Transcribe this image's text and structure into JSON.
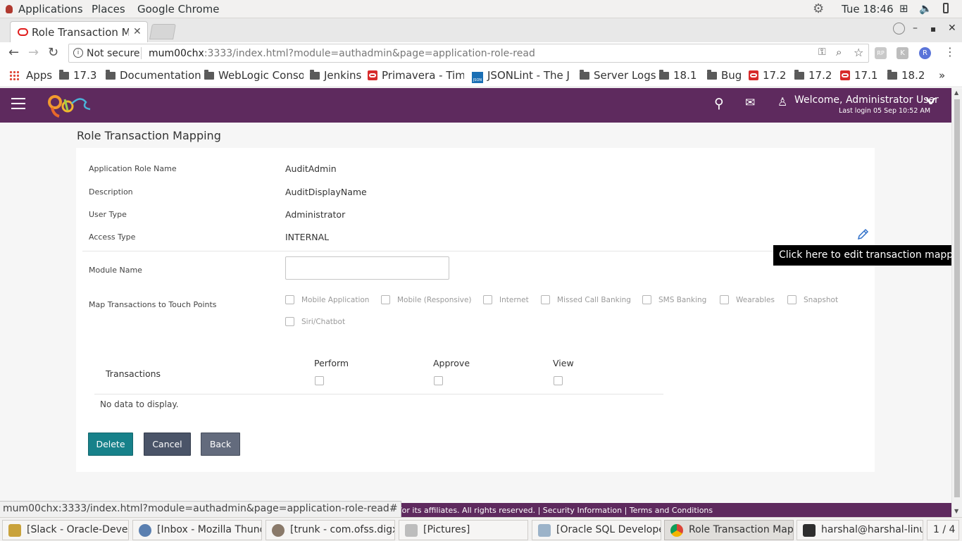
{
  "gnome": {
    "applications": "Applications",
    "places": "Places",
    "app_name": "Google Chrome",
    "clock": "Tue 18:46"
  },
  "browser": {
    "tab_title": "Role Transaction Ma",
    "not_secure": "Not secure",
    "url_host": "mum00chx",
    "url_rest": ":3333/index.html?module=authadmin&page=application-role-read",
    "ext_rp": "RP",
    "ext_k": "K",
    "ext_r": "R",
    "more": "»"
  },
  "bookmarks": {
    "apps": "Apps",
    "items": [
      {
        "label": "17.3",
        "icon": "folder-icon"
      },
      {
        "label": "Documentation",
        "icon": "folder-icon"
      },
      {
        "label": "WebLogic Conso",
        "icon": "folder-icon"
      },
      {
        "label": "Jenkins",
        "icon": "folder-icon"
      },
      {
        "label": "Primavera - Time",
        "icon": "oracle-icon"
      },
      {
        "label": "JSONLint - The J",
        "icon": "json-icon"
      },
      {
        "label": "Server Logs",
        "icon": "folder-icon"
      },
      {
        "label": "18.1",
        "icon": "folder-icon"
      },
      {
        "label": "Bug",
        "icon": "folder-icon"
      },
      {
        "label": "17.2",
        "icon": "oracle-icon"
      },
      {
        "label": "17.2",
        "icon": "folder-icon"
      },
      {
        "label": "17.1",
        "icon": "oracle-icon"
      },
      {
        "label": "18.2",
        "icon": "folder-icon"
      }
    ],
    "json_badge": "JSON"
  },
  "header": {
    "welcome": "Welcome, Administrator User",
    "last_login": "Last login 05 Sep 10:52 AM"
  },
  "page": {
    "title": "Role Transaction Mapping",
    "fields": [
      {
        "label": "Application Role Name",
        "value": "AuditAdmin"
      },
      {
        "label": "Description",
        "value": "AuditDisplayName"
      },
      {
        "label": "User Type",
        "value": "Administrator"
      },
      {
        "label": "Access Type",
        "value": "INTERNAL"
      }
    ],
    "module_name_label": "Module Name",
    "module_name_value": "",
    "touch_points_label": "Map Transactions to Touch Points",
    "touch_points": [
      "Mobile Application",
      "Mobile (Responsive)",
      "Internet",
      "Missed Call Banking",
      "SMS Banking",
      "Wearables",
      "Snapshot",
      "Siri/Chatbot"
    ],
    "table": {
      "transactions_header": "Transactions",
      "columns": [
        "Perform",
        "Approve",
        "View"
      ],
      "empty": "No data to display."
    },
    "buttons": {
      "delete": "Delete",
      "cancel": "Cancel",
      "back": "Back"
    },
    "tooltip": "Click here to edit transaction mapping"
  },
  "footer": {
    "text": "e and/or its affiliates. All rights reserved. | Security Information | Terms and Conditions",
    "status_url": "mum00chx:3333/index.html?module=authadmin&page=application-role-read#"
  },
  "taskbar": {
    "items": [
      "[Slack - Oracle-Develo...",
      "[Inbox - Mozilla Thund...",
      "[trunk - com.ofss.digx....",
      "[Pictures]",
      "[Oracle SQL Developer...",
      "Role Transaction Mapp...",
      "harshal@harshal-linux:~"
    ],
    "workspace": "1 / 4"
  },
  "colors": {
    "brand_purple": "#5e2a5e",
    "delete_teal": "#17818a",
    "cancel_slate": "#4a5468",
    "back_slate": "#636b7d"
  }
}
